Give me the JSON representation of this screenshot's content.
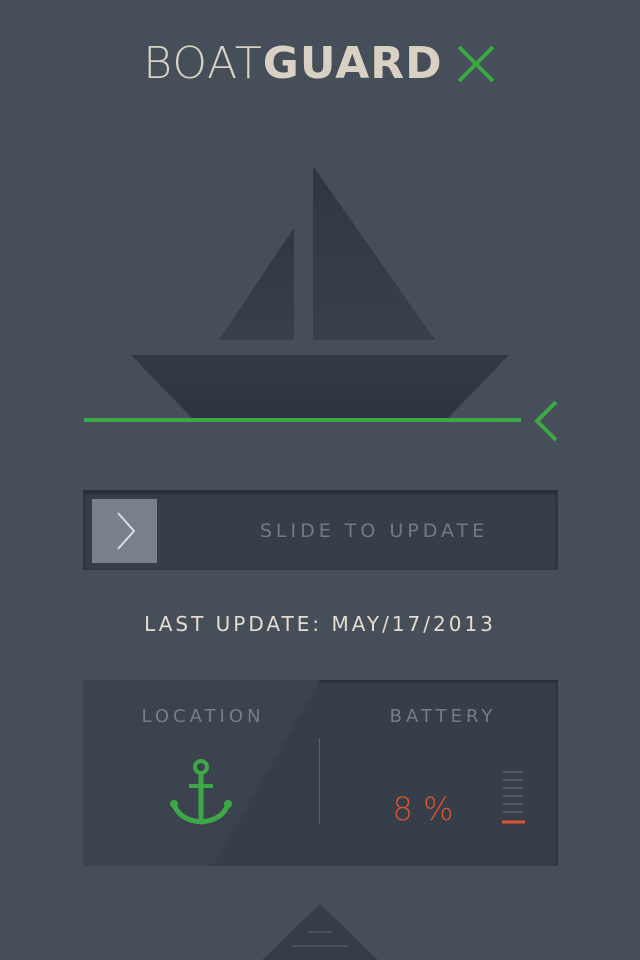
{
  "app": {
    "title_light": "BOAT",
    "title_bold": "GUARD"
  },
  "icons": {
    "logo_mark": "close-x-icon",
    "boat": "sailboat-icon",
    "waterline_arrow": "chevron-left-icon",
    "slider_arrow": "chevron-right-icon",
    "location": "anchor-icon",
    "battery_level": "battery-bars-icon",
    "bottom_tab": "pull-up-tab-icon"
  },
  "slider": {
    "label": "SLIDE TO UPDATE"
  },
  "status": {
    "last_update": "LAST UPDATE: MAY/17/2013"
  },
  "location": {
    "label": "LOCATION"
  },
  "battery": {
    "label": "BATTERY",
    "value_text": "8 %",
    "level_percent": 8
  },
  "colors": {
    "background": "#464f59",
    "accent_green": "#3da846",
    "alert_red": "#d9542f",
    "logo_text": "#d8d1c4",
    "panel": "#363f49"
  }
}
